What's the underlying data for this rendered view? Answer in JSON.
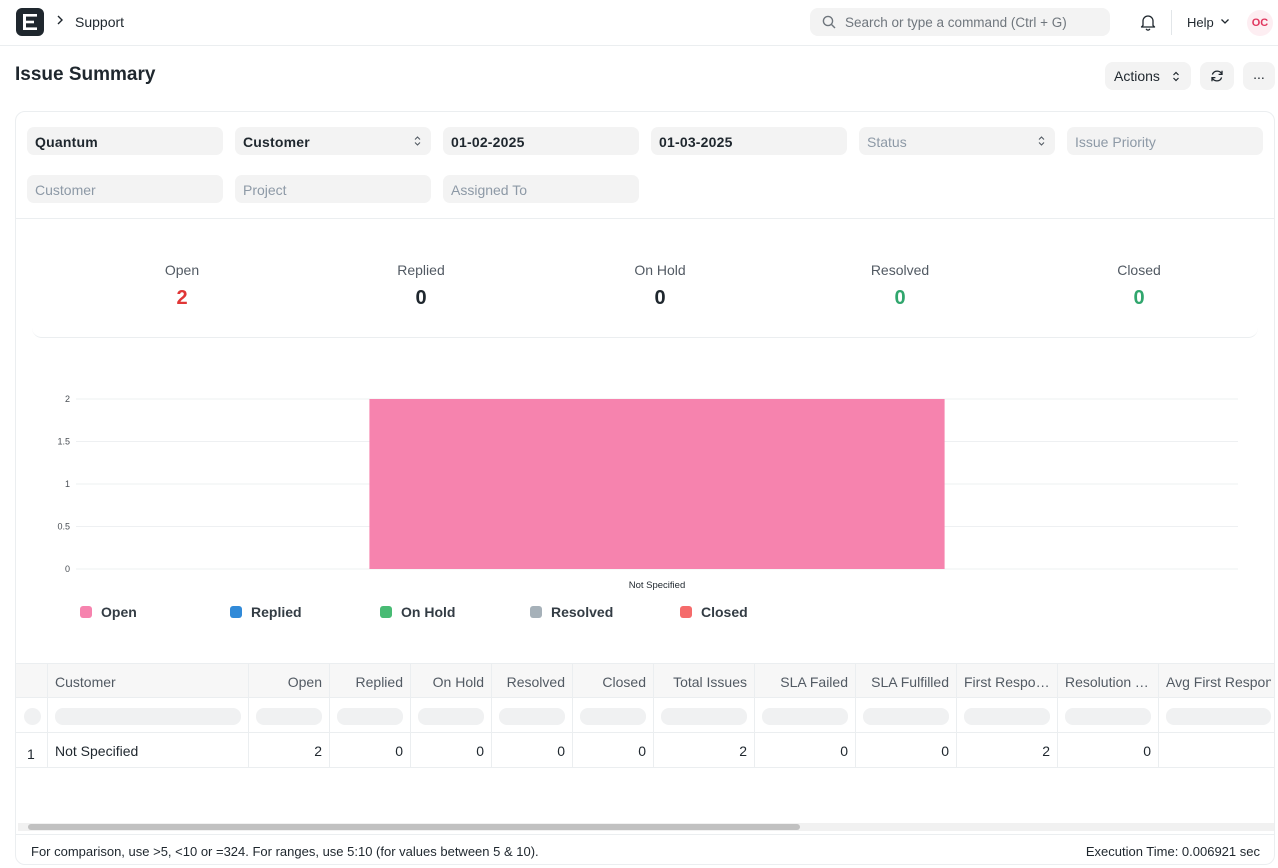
{
  "navbar": {
    "breadcrumb": "Support",
    "search_placeholder": "Search or type a command (Ctrl + G)",
    "help_label": "Help",
    "avatar_initials": "OC"
  },
  "page": {
    "title": "Issue Summary",
    "actions_label": "Actions",
    "more_label": "..."
  },
  "filters": {
    "company": "Quantum",
    "based_on": "Customer",
    "from_date": "01-02-2025",
    "to_date": "01-03-2025",
    "status_placeholder": "Status",
    "priority_placeholder": "Issue Priority",
    "customer_placeholder": "Customer",
    "project_placeholder": "Project",
    "assigned_to_placeholder": "Assigned To"
  },
  "summary": [
    {
      "label": "Open",
      "value": "2",
      "color": "#e03636"
    },
    {
      "label": "Replied",
      "value": "0",
      "color": "#1f272e"
    },
    {
      "label": "On Hold",
      "value": "0",
      "color": "#1f272e"
    },
    {
      "label": "Resolved",
      "value": "0",
      "color": "#30a66d"
    },
    {
      "label": "Closed",
      "value": "0",
      "color": "#30a66d"
    }
  ],
  "chart_data": {
    "type": "bar",
    "categories": [
      "Not Specified"
    ],
    "series": [
      {
        "name": "Open",
        "values": [
          2
        ],
        "color": "#f683ae"
      },
      {
        "name": "Replied",
        "values": [
          0
        ],
        "color": "#318ad8"
      },
      {
        "name": "On Hold",
        "values": [
          0
        ],
        "color": "#48bb74"
      },
      {
        "name": "Resolved",
        "values": [
          0
        ],
        "color": "#a6b1b9"
      },
      {
        "name": "Closed",
        "values": [
          0
        ],
        "color": "#f56b6b"
      }
    ],
    "yticks": [
      "0",
      "0.5",
      "1",
      "1.5",
      "2"
    ],
    "ylim": [
      0,
      2
    ],
    "title": "",
    "xlabel": "",
    "ylabel": "",
    "legend_position": "bottom-left",
    "grid": true
  },
  "table": {
    "columns": [
      "Customer",
      "Open",
      "Replied",
      "On Hold",
      "Resolved",
      "Closed",
      "Total Issues",
      "SLA Failed",
      "SLA Fulfilled",
      "First Response Time",
      "Resolution Time",
      "Avg First Response"
    ],
    "rows": [
      {
        "index": "1",
        "cells": [
          "Not Specified",
          "2",
          "0",
          "0",
          "0",
          "0",
          "2",
          "0",
          "0",
          "2",
          "0",
          ""
        ]
      }
    ]
  },
  "footer": {
    "hint": "For comparison, use >5, <10 or =324. For ranges, use 5:10 (for values between 5 & 10).",
    "execution_time": "Execution Time: 0.006921 sec"
  }
}
